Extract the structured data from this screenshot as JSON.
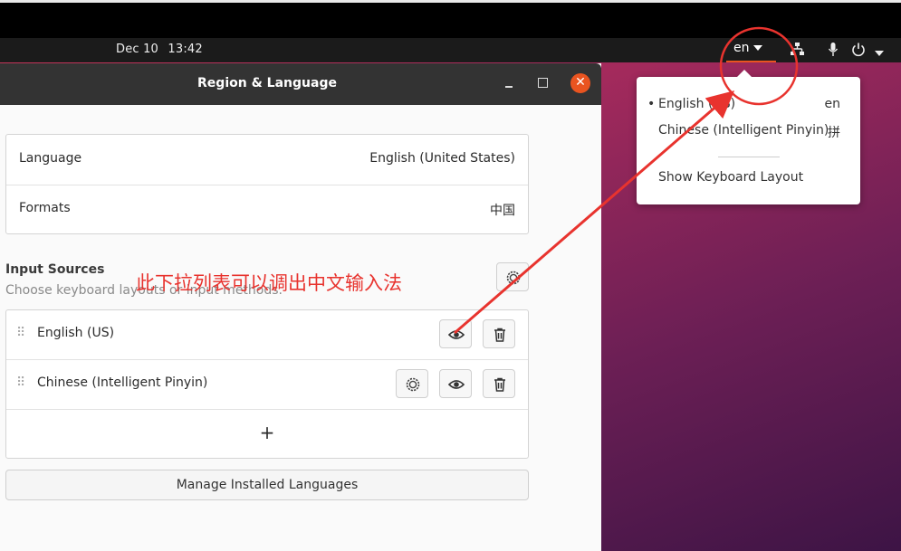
{
  "topbar": {
    "date": "Dec 10",
    "time": "13:42",
    "input_indicator": "en",
    "tray_icons": [
      "network-icon",
      "microphone-icon",
      "power-icon",
      "chevron-down-icon"
    ]
  },
  "input_menu": {
    "items": [
      {
        "label": "English (US)",
        "code": "en",
        "active": true
      },
      {
        "label": "Chinese (Intelligent Pinyin)",
        "code": "拼",
        "active": false
      }
    ],
    "bullet": "•",
    "show_layout": "Show Keyboard Layout"
  },
  "window": {
    "title": "Region & Language",
    "close_glyph": "✕"
  },
  "language_card": {
    "language_label": "Language",
    "language_value": "English (United States)",
    "formats_label": "Formats",
    "formats_value": "中国"
  },
  "input_sources": {
    "title": "Input Sources",
    "subtitle": "Choose keyboard layouts or input methods.",
    "sources": [
      "English (US)",
      "Chinese (Intelligent Pinyin)"
    ],
    "drag_glyph": "⠿",
    "add_glyph": "+"
  },
  "manage_button": "Manage Installed Languages",
  "annotation": {
    "text": "此下拉列表可以调出中文输入法",
    "color": "#e8332e"
  },
  "colors": {
    "accent": "#e95420",
    "titlebar": "#333333"
  }
}
